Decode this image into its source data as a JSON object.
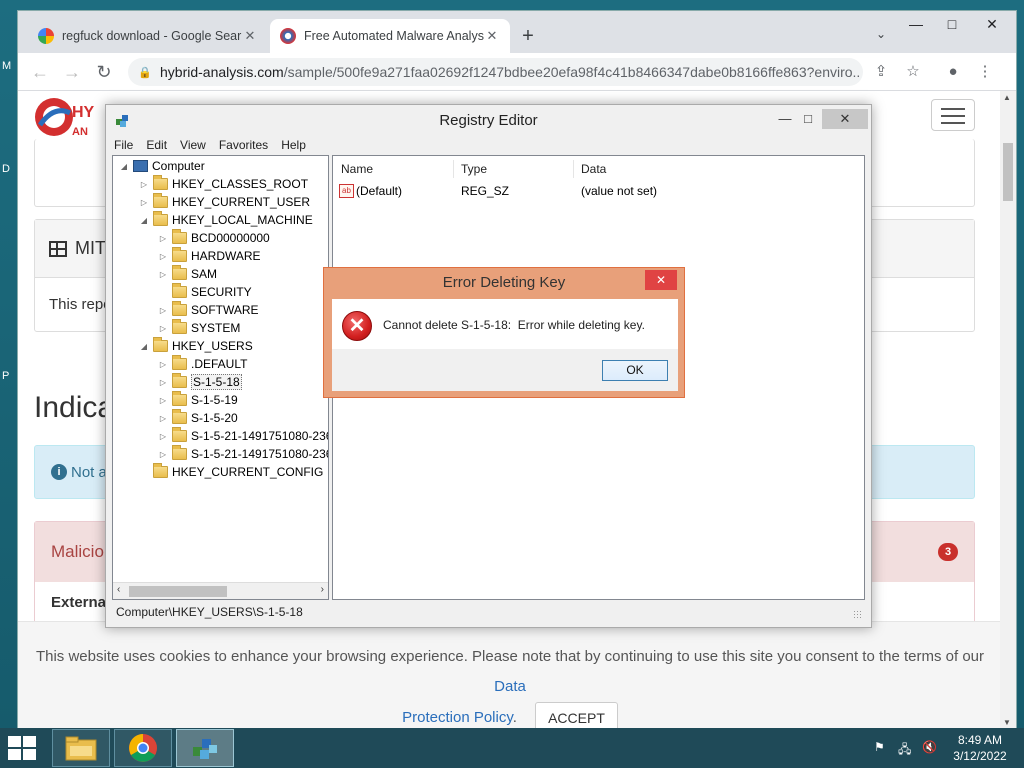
{
  "browser": {
    "tabs": [
      {
        "title": "regfuck download - Google Sear",
        "active": false
      },
      {
        "title": "Free Automated Malware Analys",
        "active": true
      }
    ],
    "url_host": "hybrid-analysis.com",
    "url_path": "/sample/500fe9a271faa02692f1247bdbee20efa98f4c41b8466347dabe0b8166ffe863?enviro..."
  },
  "page": {
    "logo_top": "HY",
    "logo_bottom": "AN",
    "card_mitre_title": "MIT",
    "card_mitre_body": "This repo",
    "indicators_heading": "Indica",
    "info_alert": "Not a",
    "malicious_title": "Malicio",
    "malicious_count": "3",
    "external_label": "External",
    "cookie_text": "This website uses cookies to enhance your browsing experience. Please note that by continuing to use this site you consent to the terms of our",
    "cookie_link": "Data Protection Policy",
    "cookie_link_part1": "Data",
    "cookie_link_part2": "Protection Policy",
    "cookie_period": ".",
    "accept_label": "ACCEPT"
  },
  "regedit": {
    "title": "Registry Editor",
    "menu": [
      "File",
      "Edit",
      "View",
      "Favorites",
      "Help"
    ],
    "tree": [
      {
        "label": "Computer",
        "level": 0,
        "expanded": true,
        "icon": "computer"
      },
      {
        "label": "HKEY_CLASSES_ROOT",
        "level": 1,
        "expanded": false
      },
      {
        "label": "HKEY_CURRENT_USER",
        "level": 1,
        "expanded": false
      },
      {
        "label": "HKEY_LOCAL_MACHINE",
        "level": 1,
        "expanded": true
      },
      {
        "label": "BCD00000000",
        "level": 2,
        "expanded": false
      },
      {
        "label": "HARDWARE",
        "level": 2,
        "expanded": false
      },
      {
        "label": "SAM",
        "level": 2,
        "expanded": false
      },
      {
        "label": "SECURITY",
        "level": 2,
        "expanded": null
      },
      {
        "label": "SOFTWARE",
        "level": 2,
        "expanded": false
      },
      {
        "label": "SYSTEM",
        "level": 2,
        "expanded": false
      },
      {
        "label": "HKEY_USERS",
        "level": 1,
        "expanded": true
      },
      {
        "label": ".DEFAULT",
        "level": 2,
        "expanded": false
      },
      {
        "label": "S-1-5-18",
        "level": 2,
        "expanded": false,
        "selected": true
      },
      {
        "label": "S-1-5-19",
        "level": 2,
        "expanded": false
      },
      {
        "label": "S-1-5-20",
        "level": 2,
        "expanded": false
      },
      {
        "label": "S-1-5-21-1491751080-236",
        "level": 2,
        "expanded": false
      },
      {
        "label": "S-1-5-21-1491751080-236",
        "level": 2,
        "expanded": false
      },
      {
        "label": "HKEY_CURRENT_CONFIG",
        "level": 1,
        "expanded": null
      }
    ],
    "columns": {
      "name": "Name",
      "type": "Type",
      "data": "Data"
    },
    "values": [
      {
        "name": "(Default)",
        "type": "REG_SZ",
        "data": "(value not set)"
      }
    ],
    "status_path": "Computer\\HKEY_USERS\\S-1-5-18"
  },
  "error_dialog": {
    "title": "Error Deleting Key",
    "message": "Cannot delete S-1-5-18:  Error while deleting key.",
    "ok_label": "OK"
  },
  "taskbar": {
    "time": "8:49 AM",
    "date": "3/12/2022"
  },
  "colors": {
    "dialog_accent": "#e8a07a",
    "taskbar": "#1f4a58",
    "desktop": "#1b6a7d"
  }
}
